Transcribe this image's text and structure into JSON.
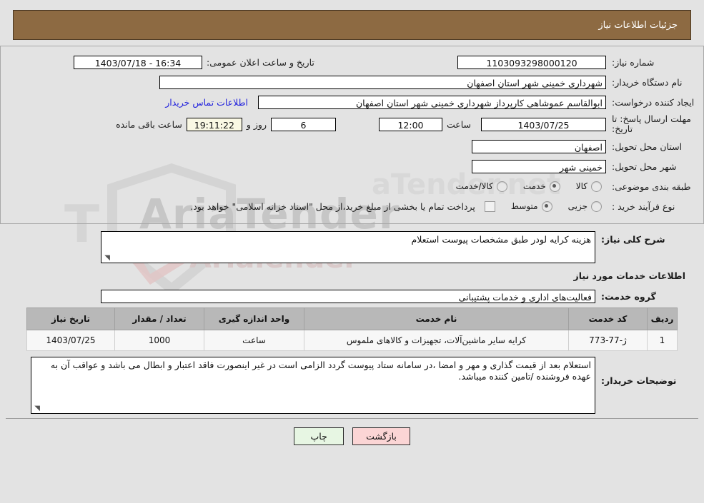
{
  "header": {
    "title": "جزئیات اطلاعات نیاز"
  },
  "form": {
    "need_number_label": "شماره نیاز:",
    "need_number_value": "1103093298000120",
    "announce_datetime_label": "تاریخ و ساعت اعلان عمومی:",
    "announce_datetime_value": "16:34 - 1403/07/18",
    "buyer_org_label": "نام دستگاه خریدار:",
    "buyer_org_value": "شهرداری خمینی شهر استان اصفهان",
    "requester_label": "ایجاد کننده درخواست:",
    "requester_value": "ابوالقاسم عموشاهی کارپرداز شهرداری خمینی شهر استان اصفهان",
    "contact_link": "اطلاعات تماس خریدار",
    "deadline_label": "مهلت ارسال پاسخ: تا تاریخ:",
    "deadline_date": "1403/07/25",
    "hour_label": "ساعت",
    "deadline_time": "12:00",
    "days_remaining": "6",
    "days_label": "روز و",
    "time_remaining": "19:11:22",
    "hours_remaining_label": "ساعت باقی مانده",
    "province_label": "استان محل تحویل:",
    "province_value": "اصفهان",
    "city_label": "شهر محل تحویل:",
    "city_value": "خمینی شهر",
    "category_label": "طبقه بندی موضوعی:",
    "category_options": [
      {
        "label": "کالا",
        "selected": false
      },
      {
        "label": "خدمت",
        "selected": true
      },
      {
        "label": "کالا/خدمت",
        "selected": false
      }
    ],
    "process_label": "نوع فرآیند خرید :",
    "process_options": [
      {
        "label": "جزیی",
        "selected": false
      },
      {
        "label": "متوسط",
        "selected": true
      }
    ],
    "treasury_checkbox_label": "پرداخت تمام یا بخشی از مبلغ خرید،از محل \"اسناد خزانه اسلامی\" خواهد بود.",
    "treasury_checked": false
  },
  "middle": {
    "general_desc_label": "شرح کلی نیاز:",
    "general_desc_value": "هزینه کرایه لودر طبق مشخصات پیوست استعلام",
    "services_section_title": "اطلاعات خدمات مورد نیاز",
    "service_group_label": "گروه خدمت:",
    "service_group_value": "فعالیت‌های اداری و خدمات پشتیبانی"
  },
  "table": {
    "columns": [
      "ردیف",
      "کد خدمت",
      "نام خدمت",
      "واحد اندازه گیری",
      "تعداد / مقدار",
      "تاریخ نیاز"
    ],
    "rows": [
      {
        "index": "1",
        "code": "ژ-77-773",
        "name": "کرایه سایر ماشین‌آلات، تجهیزات و کالاهای ملموس",
        "unit": "ساعت",
        "quantity": "1000",
        "date": "1403/07/25"
      }
    ]
  },
  "buyer_notes": {
    "label": "توضیحات خریدار:",
    "value": "استعلام بعد از قیمت گذاری و مهر و امضا ،در سامانه ستاد پیوست گردد الزامی است در غیر اینصورت فاقد اعتبار و ابطال می باشد و عواقب آن به عهده فروشنده /تامین کننده میباشد."
  },
  "footer": {
    "print_label": "چاپ",
    "back_label": "بازگشت"
  },
  "colors": {
    "title_bar": "#8d6a42",
    "page_bg": "#e3e3e3",
    "link": "#2222dd",
    "table_header": "#b8b8b8",
    "print_button": "#e7f6e3",
    "back_button": "#fbd5d5"
  },
  "watermark": {
    "text1": "AriaTender",
    "text2": "T",
    "text3": "Arialender",
    "text4": "aTender.net"
  }
}
